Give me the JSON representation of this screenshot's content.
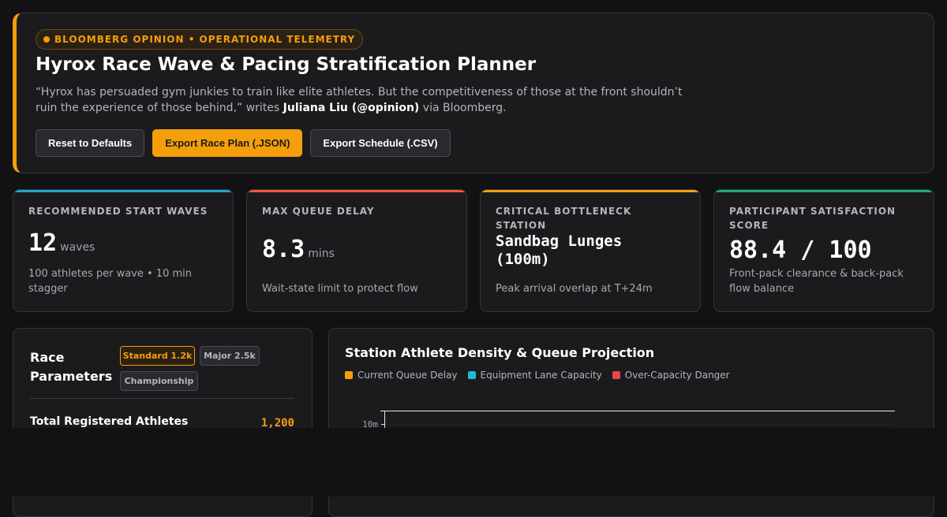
{
  "header": {
    "badge": "BLOOMBERG OPINION • OPERATIONAL TELEMETRY",
    "title": "Hyrox Race Wave & Pacing Stratification Planner",
    "quote_text": "“Hyrox has persuaded gym junkies to train like elite athletes. But the competitiveness of those at the front shouldn’t ruin the experience of those behind,” writes ",
    "quote_author": "Juliana Liu (@opinion)",
    "quote_suffix": " via Bloomberg.",
    "buttons": {
      "reset": "Reset to Defaults",
      "export_json": "Export Race Plan (.JSON)",
      "export_csv": "Export Schedule (.CSV)"
    }
  },
  "metrics": [
    {
      "label": "RECOMMENDED START WAVES",
      "value": "12",
      "unit": "waves",
      "sub": "100 athletes per wave • 10 min stagger",
      "accent": "#22a6c8"
    },
    {
      "label": "MAX QUEUE DELAY",
      "value": "8.3",
      "unit": "mins",
      "sub": "Wait-state limit to protect flow",
      "accent": "#f05a3a"
    },
    {
      "label": "CRITICAL BOTTLENECK STATION",
      "value": "Sandbag Lunges (100m)",
      "unit": "",
      "sub": "Peak arrival overlap at T+24m",
      "accent": "#f59e0b"
    },
    {
      "label": "PARTICIPANT SATISFACTION SCORE",
      "value": "88.4 / 100",
      "unit": "",
      "sub": "Front-pack clearance & back-pack flow balance",
      "accent": "#21a87a"
    }
  ],
  "params": {
    "title": "Race Parameters",
    "presets": [
      "Standard 1.2k",
      "Major 2.5k",
      "Championship"
    ],
    "active_preset": "Standard 1.2k",
    "rows": [
      {
        "label": "Total Registered Athletes",
        "value": "1,200"
      }
    ]
  },
  "chart_data": {
    "type": "bar",
    "title": "Station Athlete Density & Queue Projection",
    "series": [
      {
        "name": "Current Queue Delay",
        "color": "#f59e0b"
      },
      {
        "name": "Equipment Lane Capacity",
        "color": "#22b8d6"
      },
      {
        "name": "Over-Capacity Danger",
        "color": "#e5484d"
      }
    ],
    "tick_labels": [
      "10m"
    ]
  }
}
